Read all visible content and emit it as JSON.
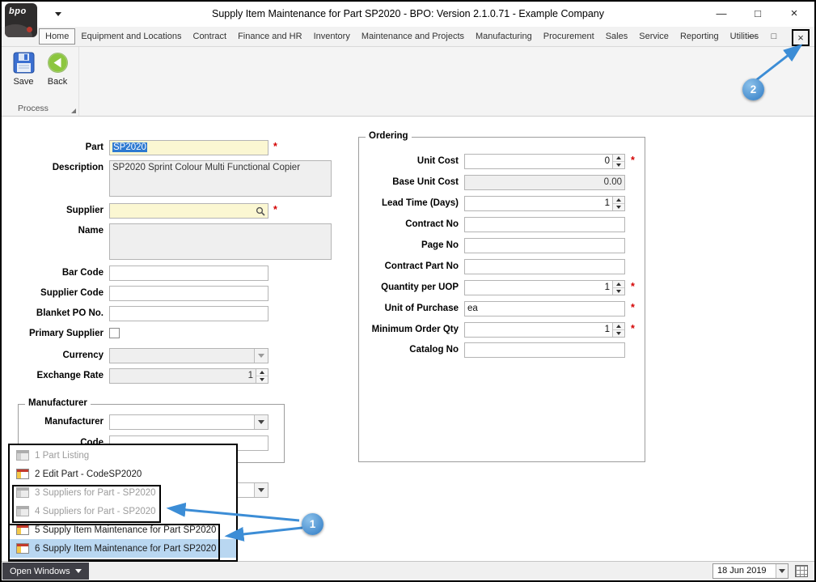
{
  "window": {
    "title": "Supply Item Maintenance for Part SP2020 - BPO: Version 2.1.0.71 - Example Company",
    "logo_text": "bpo",
    "controls": {
      "minimize": "—",
      "maximize": "□",
      "close": "×"
    }
  },
  "menubar": {
    "tabs": [
      "Home",
      "Equipment and Locations",
      "Contract",
      "Finance and HR",
      "Inventory",
      "Maintenance and Projects",
      "Manufacturing",
      "Procurement",
      "Sales",
      "Service",
      "Reporting",
      "Utilities"
    ],
    "active_tab": "Home",
    "window_icons": {
      "minimize": "—",
      "restore": "□",
      "close": "×"
    }
  },
  "ribbon": {
    "save_label": "Save",
    "back_label": "Back",
    "group_label": "Process"
  },
  "required_marker": "*",
  "form": {
    "part": {
      "label": "Part",
      "value": "SP2020"
    },
    "description": {
      "label": "Description",
      "value": "SP2020 Sprint Colour Multi Functional Copier"
    },
    "supplier": {
      "label": "Supplier",
      "value": ""
    },
    "name": {
      "label": "Name",
      "value": ""
    },
    "bar_code": {
      "label": "Bar Code",
      "value": ""
    },
    "supplier_code": {
      "label": "Supplier Code",
      "value": ""
    },
    "blanket_po": {
      "label": "Blanket PO No.",
      "value": ""
    },
    "primary_supplier": {
      "label": "Primary Supplier",
      "checked": false
    },
    "currency": {
      "label": "Currency",
      "value": ""
    },
    "exchange_rate": {
      "label": "Exchange Rate",
      "value": "1"
    },
    "manufacturer_group": {
      "title": "Manufacturer",
      "manufacturer_label": "Manufacturer",
      "manufacturer_value": "",
      "code_label": "Code",
      "code_value": ""
    },
    "ordering": {
      "title": "Ordering",
      "rows": [
        {
          "label": "Unit Cost",
          "value": "0",
          "type": "spinner",
          "required": true
        },
        {
          "label": "Base Unit Cost",
          "value": "0.00",
          "type": "disabled",
          "required": false
        },
        {
          "label": "Lead Time (Days)",
          "value": "1",
          "type": "spinner",
          "required": false
        },
        {
          "label": "Contract No",
          "value": "",
          "type": "text",
          "required": false
        },
        {
          "label": "Page No",
          "value": "",
          "type": "text",
          "required": false
        },
        {
          "label": "Contract Part No",
          "value": "",
          "type": "text",
          "required": false
        },
        {
          "label": "Quantity per UOP",
          "value": "1",
          "type": "spinner",
          "required": true
        },
        {
          "label": "Unit of Purchase",
          "value": "ea",
          "type": "text",
          "required": true
        },
        {
          "label": "Minimum Order Qty",
          "value": "1",
          "type": "spinner",
          "required": true
        },
        {
          "label": "Catalog No",
          "value": "",
          "type": "text",
          "required": false
        }
      ]
    }
  },
  "popup": {
    "items": [
      {
        "label": "1 Part Listing",
        "state": "disabled"
      },
      {
        "label": "2 Edit Part - CodeSP2020",
        "state": "normal"
      },
      {
        "label": "3 Suppliers for Part - SP2020",
        "state": "disabled"
      },
      {
        "label": "4 Suppliers for Part - SP2020",
        "state": "disabled"
      },
      {
        "label": "5 Supply Item Maintenance for Part SP2020",
        "state": "normal"
      },
      {
        "label": "6 Supply Item Maintenance for Part SP2020",
        "state": "selected"
      }
    ]
  },
  "statusbar": {
    "open_windows_label": "Open Windows",
    "date_value": "18 Jun 2019"
  },
  "annotations": {
    "badge1": "1",
    "badge2": "2"
  }
}
